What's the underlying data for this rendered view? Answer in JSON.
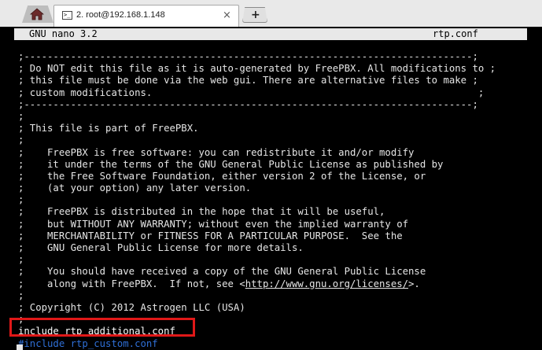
{
  "tab": {
    "title": "2. root@192.168.1.148",
    "close_glyph": "×",
    "new_tab_glyph": "+"
  },
  "nano": {
    "version": "GNU nano 3.2",
    "filename": "rtp.conf"
  },
  "file_lines": [
    ";-----------------------------------------------------------------------------;",
    "; Do NOT edit this file as it is auto-generated by FreePBX. All modifications to ;",
    "; this file must be done via the web gui. There are alternative files to make ;",
    "; custom modifications.                                                        ;",
    ";-----------------------------------------------------------------------------;",
    ";",
    "; This file is part of FreePBX.",
    ";",
    ";    FreePBX is free software: you can redistribute it and/or modify",
    ";    it under the terms of the GNU General Public License as published by",
    ";    the Free Software Foundation, either version 2 of the License, or",
    ";    (at your option) any later version.",
    ";",
    ";    FreePBX is distributed in the hope that it will be useful,",
    ";    but WITHOUT ANY WARRANTY; without even the implied warranty of",
    ";    MERCHANTABILITY or FITNESS FOR A PARTICULAR PURPOSE.  See the",
    ";    GNU General Public License for more details.",
    ";",
    ";    You should have received a copy of the GNU General Public License",
    ";    along with FreePBX.  If not, see <",
    ";",
    "; Copyright (C) 2012 Astrogen LLC (USA)",
    ";"
  ],
  "license_link": "http://www.gnu.org/licenses/",
  "license_suffix": ">.",
  "include_line": "include rtp_additional.conf",
  "include_custom_line": "#include rtp_custom.conf",
  "colors": {
    "terminal_bg": "#000000",
    "terminal_fg": "#e6e6e6",
    "highlight_border": "#e01818",
    "comment_blue": "#2f6fd6"
  }
}
